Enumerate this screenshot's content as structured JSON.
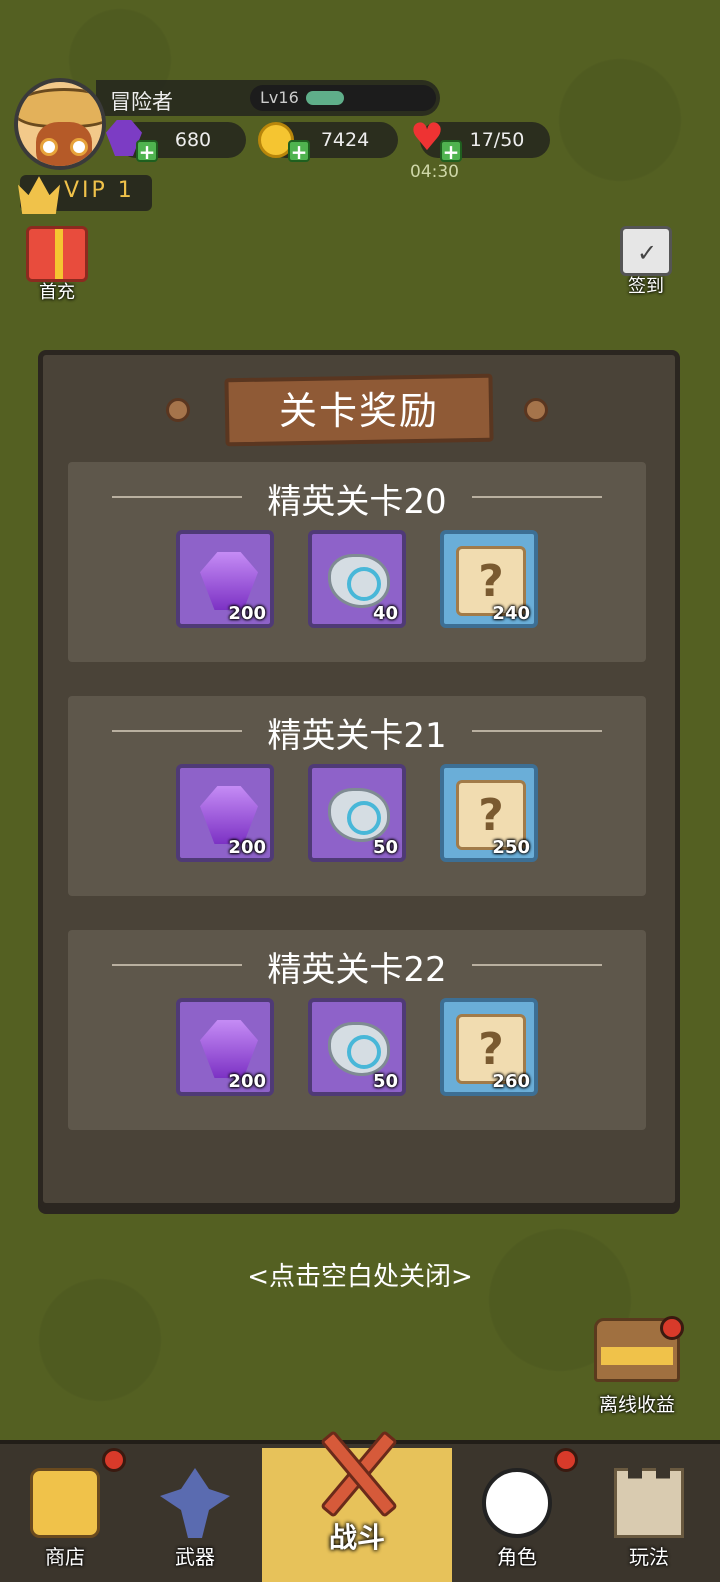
{
  "player": {
    "name": "冒险者",
    "level": "Lv16",
    "level_progress": 0.2
  },
  "resources": {
    "gems": "680",
    "coins": "7424",
    "energy": "17/50",
    "energy_timer": "04:30"
  },
  "vip": {
    "label": "VIP 1"
  },
  "side_left": {
    "first_recharge": "首充"
  },
  "side_right": {
    "checkin": "签到"
  },
  "modal": {
    "title": "关卡奖励",
    "sections": [
      {
        "title": "精英关卡20",
        "rewards": [
          {
            "icon": "gem-icon",
            "count": "200"
          },
          {
            "icon": "stone-icon",
            "count": "40"
          },
          {
            "icon": "map-scroll-icon",
            "count": "240"
          }
        ]
      },
      {
        "title": "精英关卡21",
        "rewards": [
          {
            "icon": "gem-icon",
            "count": "200"
          },
          {
            "icon": "stone-icon",
            "count": "50"
          },
          {
            "icon": "map-scroll-icon",
            "count": "250"
          }
        ]
      },
      {
        "title": "精英关卡22",
        "rewards": [
          {
            "icon": "gem-icon",
            "count": "200"
          },
          {
            "icon": "stone-icon",
            "count": "50"
          },
          {
            "icon": "map-scroll-icon",
            "count": "260"
          }
        ]
      }
    ],
    "close_hint": "<点击空白处关闭>"
  },
  "offline": {
    "label": "离线收益"
  },
  "nav": {
    "shop": "商店",
    "weapon": "武器",
    "battle": "战斗",
    "role": "角色",
    "play": "玩法"
  },
  "colors": {
    "background": "#758630",
    "modal": "#4a4338",
    "accent_gold": "#e7c25a"
  }
}
